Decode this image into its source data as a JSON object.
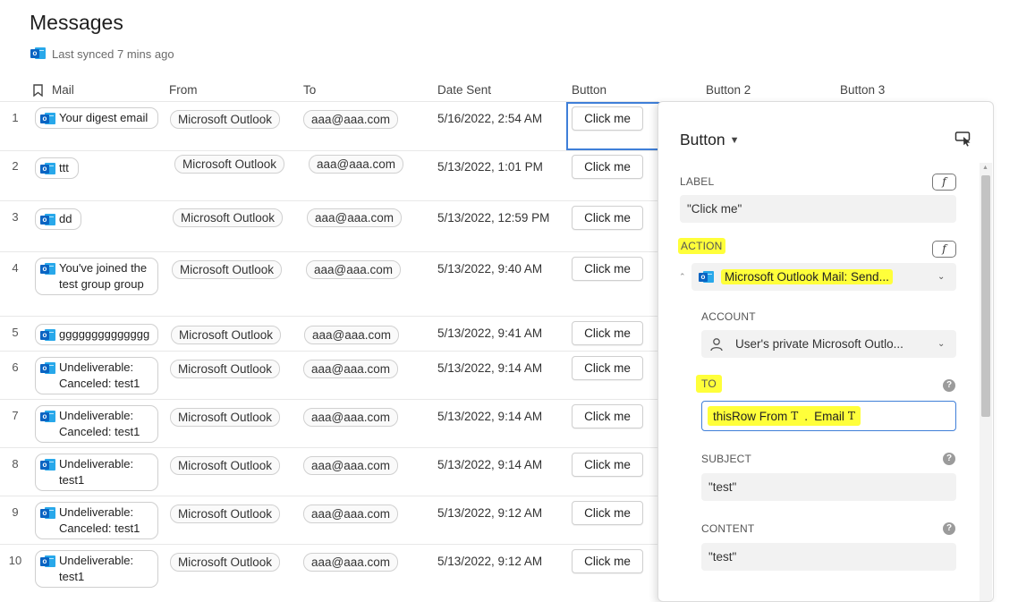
{
  "header": {
    "title": "Messages",
    "sync_text": "Last synced 7 mins ago"
  },
  "columns": [
    "Mail",
    "From",
    "To",
    "Date Sent",
    "Button",
    "Button 2",
    "Button 3"
  ],
  "rows": [
    {
      "num": "1",
      "mail": "Your digest email",
      "from": "Microsoft Outlook",
      "to": "aaa@aaa.com",
      "date": "5/16/2022, 2:54 AM",
      "button": "Click me"
    },
    {
      "num": "2",
      "mail": "ttt",
      "from": "Microsoft Outlook",
      "to": "aaa@aaa.com",
      "date": "5/13/2022, 1:01 PM",
      "button": "Click me"
    },
    {
      "num": "3",
      "mail": "dd",
      "from": "Microsoft Outlook",
      "to": "aaa@aaa.com",
      "date": "5/13/2022, 12:59 PM",
      "button": "Click me"
    },
    {
      "num": "4",
      "mail": "You've joined the test group group",
      "from": "Microsoft Outlook",
      "to": "aaa@aaa.com",
      "date": "5/13/2022, 9:40 AM",
      "button": "Click me"
    },
    {
      "num": "5",
      "mail": "gggggggggggggg",
      "from": "Microsoft Outlook",
      "to": "aaa@aaa.com",
      "date": "5/13/2022, 9:41 AM",
      "button": "Click me"
    },
    {
      "num": "6",
      "mail": "Undeliverable: Canceled: test1",
      "from": "Microsoft Outlook",
      "to": "aaa@aaa.com",
      "date": "5/13/2022, 9:14 AM",
      "button": "Click me"
    },
    {
      "num": "7",
      "mail": "Undeliverable: Canceled: test1",
      "from": "Microsoft Outlook",
      "to": "aaa@aaa.com",
      "date": "5/13/2022, 9:14 AM",
      "button": "Click me"
    },
    {
      "num": "8",
      "mail": "Undeliverable: test1",
      "from": "Microsoft Outlook",
      "to": "aaa@aaa.com",
      "date": "5/13/2022, 9:14 AM",
      "button": "Click me"
    },
    {
      "num": "9",
      "mail": "Undeliverable: Canceled: test1",
      "from": "Microsoft Outlook",
      "to": "aaa@aaa.com",
      "date": "5/13/2022, 9:12 AM",
      "button": "Click me"
    },
    {
      "num": "10",
      "mail": "Undeliverable: test1",
      "from": "Microsoft Outlook",
      "to": "aaa@aaa.com",
      "date": "5/13/2022, 9:12 AM",
      "button": "Click me"
    }
  ],
  "panel": {
    "title": "Button",
    "label_label": "LABEL",
    "label_value": "\"Click me\"",
    "fx": "f",
    "action_label": "ACTION",
    "action_value": "Microsoft  Outlook  Mail: Send...",
    "account_label": "ACCOUNT",
    "account_value": "User's private Microsoft Outlo...",
    "to_label": "TO",
    "to_token1": "thisRow",
    "to_token2": "From",
    "to_sep": ".",
    "to_token3": "Email",
    "type_tag": "T",
    "subject_label": "SUBJECT",
    "subject_value": "\"test\"",
    "content_label": "CONTENT",
    "content_value": "\"test\"",
    "help_symbol": "?"
  },
  "colors": {
    "highlight": "#ffff3a",
    "outlook_blue": "#0a64c2",
    "focus_blue": "#3f7fd8"
  },
  "icons": [
    "outlook-icon",
    "bookmark-icon",
    "chevron-down-icon",
    "cursor-box-icon",
    "person-icon",
    "help-icon"
  ]
}
